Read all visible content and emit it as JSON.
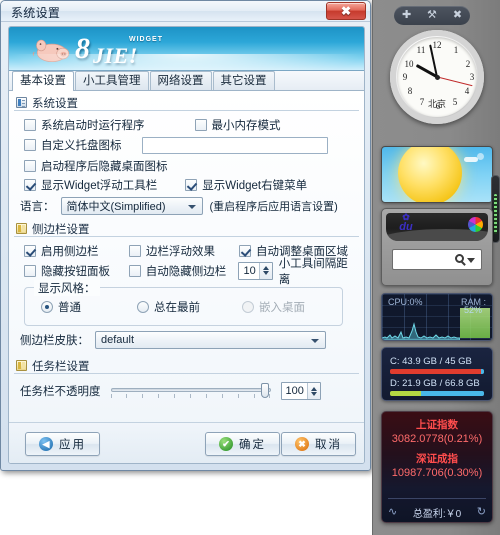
{
  "window": {
    "title": "系统设置",
    "close_label": "✖"
  },
  "banner": {
    "logo_8": "8",
    "logo_jie": "JIE!",
    "logo_widget": "WIDGET"
  },
  "tabs": [
    {
      "label": "基本设置",
      "active": true
    },
    {
      "label": "小工具管理",
      "active": false
    },
    {
      "label": "网络设置",
      "active": false
    },
    {
      "label": "其它设置",
      "active": false
    }
  ],
  "system_group": {
    "title": "系统设置",
    "run_at_startup": {
      "label": "系统启动时运行程序",
      "checked": false
    },
    "min_memory_mode": {
      "label": "最小内存模式",
      "checked": false
    },
    "custom_tray_icon": {
      "label": "自定义托盘图标",
      "checked": false
    },
    "tray_icon_path": {
      "value": "",
      "placeholder": ""
    },
    "hide_desktop_icon": {
      "label": "启动程序后隐藏桌面图标",
      "checked": false
    },
    "show_float_toolbar": {
      "label": "显示Widget浮动工具栏",
      "checked": true
    },
    "show_context_menu": {
      "label": "显示Widget右键菜单",
      "checked": true
    },
    "language_label": "语言：",
    "language_value": "简体中文(Simplified)",
    "language_note": "(重启程序后应用语言设置)"
  },
  "sidebar_group": {
    "title": "侧边栏设置",
    "enable_sidebar": {
      "label": "启用侧边栏",
      "checked": true
    },
    "float_effect": {
      "label": "边栏浮动效果",
      "checked": false
    },
    "auto_adjust_desktop": {
      "label": "自动调整桌面区域",
      "checked": true
    },
    "hide_button_panel": {
      "label": "隐藏按钮面板",
      "checked": false
    },
    "auto_hide_sidebar": {
      "label": "自动隐藏侧边栏",
      "checked": false
    },
    "gadget_spacing_value": "10",
    "gadget_spacing_label": "小工具间隔距离",
    "display_style_legend": "显示风格：",
    "style_options": [
      {
        "label": "普通",
        "selected": true,
        "disabled": false
      },
      {
        "label": "总在最前",
        "selected": false,
        "disabled": false
      },
      {
        "label": "嵌入桌面",
        "selected": false,
        "disabled": true
      }
    ],
    "skin_label": "侧边栏皮肤：",
    "skin_value": "default"
  },
  "taskbar_group": {
    "title": "任务栏设置",
    "opacity_label": "任务栏不透明度",
    "opacity_value": "100"
  },
  "buttons": {
    "apply": {
      "label": "应用",
      "icon": "back-arrow-icon"
    },
    "ok": {
      "label": "确定",
      "icon": "check-icon"
    },
    "cancel": {
      "label": "取消",
      "icon": "cancel-icon"
    }
  },
  "desktop_sidebar": {
    "toolbar": {
      "add": "✚",
      "settings": "⚒",
      "close": "✖"
    },
    "clock": {
      "city": "北京",
      "numbers": [
        "12",
        "1",
        "2",
        "3",
        "4",
        "5",
        "6",
        "7",
        "8",
        "9",
        "10",
        "11"
      ],
      "hour_deg": 299,
      "minute_deg": 348,
      "second_deg": 104
    },
    "weather": {
      "name": "weather-widget"
    },
    "baidu": {
      "paw": "✿",
      "du": "du",
      "query": "",
      "placeholder": ""
    },
    "sysmon": {
      "cpu": "CPU:0%",
      "ram": "RAM :",
      "ram_pct": "52%"
    },
    "disks": [
      {
        "text": "C: 43.9 GB / 45 GB",
        "fill_pct": 97,
        "color": "#e03c2e"
      },
      {
        "text": "D: 21.9 GB / 66.8 GB",
        "fill_pct": 33,
        "color": "#b5d943",
        "rest_color": "#49b7e8"
      }
    ],
    "stocks": [
      {
        "name": "上证指数",
        "value": "3082.0778(0.21%)"
      },
      {
        "name": "深证成指",
        "value": "10987.706(0.30%)"
      }
    ],
    "profit": "总盈利:￥0",
    "wave_icon": "∿",
    "refresh_icon": "↻"
  }
}
